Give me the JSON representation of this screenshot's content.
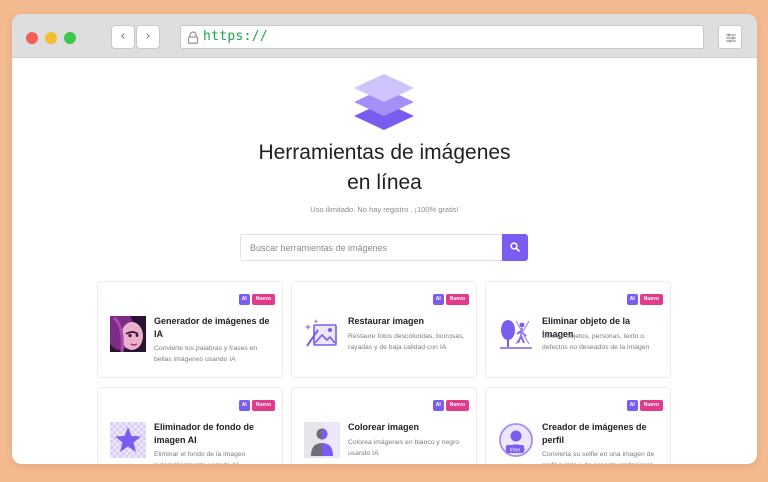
{
  "browser": {
    "url": "https://",
    "back_glyph": "‹",
    "forward_glyph": "›"
  },
  "hero": {
    "title_line1": "Herramientas de imágenes",
    "title_line2": "en línea",
    "subtitle": "Uso ilimitado. No hay registro . ¡100% gratis!"
  },
  "search": {
    "placeholder": "Buscar herramientas de imágenes"
  },
  "colors": {
    "accent": "#7b5cf0",
    "badge_new": "#e33b8c",
    "page_background": "#f3b98f"
  },
  "tools": [
    {
      "title": "Generador de imágenes de IA",
      "description": "Convierte tus palabras y frases en bellas imágenes usando IA",
      "badge_ai": "AI",
      "badge_new": "Nuevo",
      "icon": "ai-portrait-icon"
    },
    {
      "title": "Restaurar imagen",
      "description": "Restaure fotos descoloridas, borrosas, rayadas y de baja calidad con IA",
      "badge_ai": "AI",
      "badge_new": "Nuevo",
      "icon": "restore-image-icon"
    },
    {
      "title": "Eliminar objeto de la imagen",
      "description": "Elimine objetos, personas, texto o defectos no deseados de la imagen",
      "badge_ai": "AI",
      "badge_new": "Nuevo",
      "icon": "remove-object-icon"
    },
    {
      "title": "Eliminador de fondo de imagen AI",
      "description": "Eliminar el fondo de la imagen automáticamente usando AI",
      "badge_ai": "AI",
      "badge_new": "Nuevo",
      "icon": "background-remover-icon"
    },
    {
      "title": "Colorear imagen",
      "description": "Colorea imágenes en blanco y negro usando IA",
      "badge_ai": "AI",
      "badge_new": "Nuevo",
      "icon": "colorize-icon"
    },
    {
      "title": "Creador de imágenes de perfil",
      "description": "Convierta su selfie en una imagen de perfil pulida y de aspecto profesional adecuada para cualquier perfil social.",
      "badge_ai": "AI",
      "badge_new": "Nuevo",
      "icon": "profile-picture-icon",
      "icon_text": "#me"
    }
  ]
}
